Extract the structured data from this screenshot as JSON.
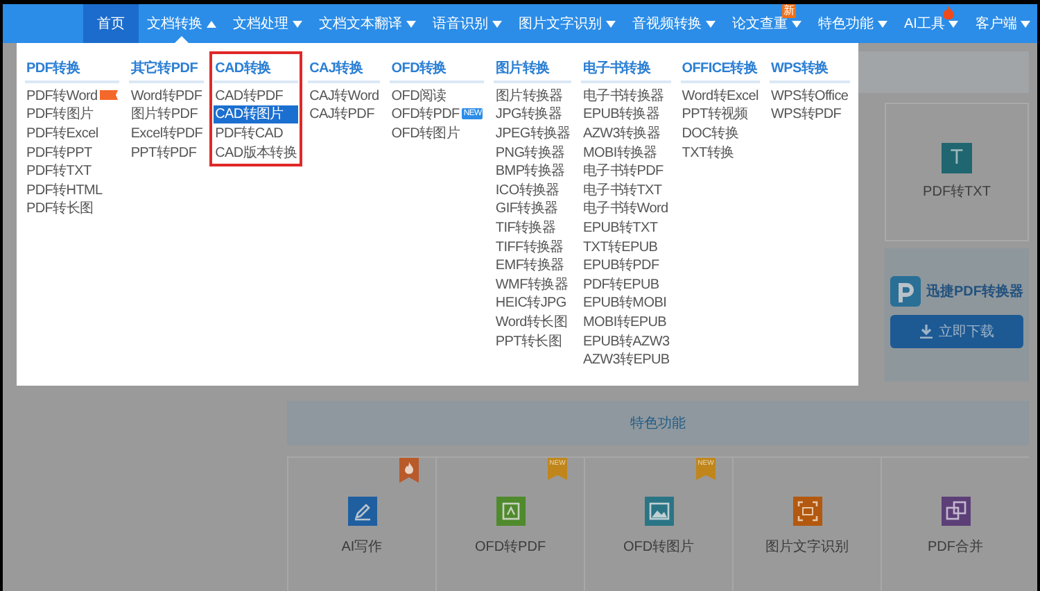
{
  "nav": {
    "items": [
      {
        "label": "首页",
        "selected": true,
        "has_menu": false,
        "expanded": false
      },
      {
        "label": "文档转换",
        "selected": false,
        "has_menu": true,
        "expanded": true
      },
      {
        "label": "文档处理",
        "selected": false,
        "has_menu": true,
        "expanded": false
      },
      {
        "label": "文档文本翻译",
        "selected": false,
        "has_menu": true,
        "expanded": false
      },
      {
        "label": "语音识别",
        "selected": false,
        "has_menu": true,
        "expanded": false
      },
      {
        "label": "图片文字识别",
        "selected": false,
        "has_menu": true,
        "expanded": false
      },
      {
        "label": "音视频转换",
        "selected": false,
        "has_menu": true,
        "expanded": false
      },
      {
        "label": "论文查重",
        "selected": false,
        "has_menu": true,
        "expanded": false,
        "badge": "新"
      },
      {
        "label": "特色功能",
        "selected": false,
        "has_menu": true,
        "expanded": false
      },
      {
        "label": "AI工具",
        "selected": false,
        "has_menu": true,
        "expanded": false,
        "hot": true
      },
      {
        "label": "客户端",
        "selected": false,
        "has_menu": true,
        "expanded": false
      }
    ]
  },
  "dropdown": {
    "columns": [
      {
        "title": "PDF转换",
        "highlighted": false,
        "items": [
          {
            "label": "PDF转Word",
            "selected": false,
            "hot_tag": true
          },
          {
            "label": "PDF转图片",
            "selected": false
          },
          {
            "label": "PDF转Excel",
            "selected": false
          },
          {
            "label": "PDF转PPT",
            "selected": false
          },
          {
            "label": "PDF转TXT",
            "selected": false
          },
          {
            "label": "PDF转HTML",
            "selected": false
          },
          {
            "label": "PDF转长图",
            "selected": false
          }
        ]
      },
      {
        "title": "其它转PDF",
        "highlighted": false,
        "items": [
          {
            "label": "Word转PDF",
            "selected": false
          },
          {
            "label": "图片转PDF",
            "selected": false
          },
          {
            "label": "Excel转PDF",
            "selected": false
          },
          {
            "label": "PPT转PDF",
            "selected": false
          }
        ]
      },
      {
        "title": "CAD转换",
        "highlighted": true,
        "items": [
          {
            "label": "CAD转PDF",
            "selected": false
          },
          {
            "label": "CAD转图片",
            "selected": true
          },
          {
            "label": "PDF转CAD",
            "selected": false
          },
          {
            "label": "CAD版本转换",
            "selected": false
          }
        ]
      },
      {
        "title": "CAJ转换",
        "highlighted": false,
        "items": [
          {
            "label": "CAJ转Word",
            "selected": false
          },
          {
            "label": "CAJ转PDF",
            "selected": false
          }
        ]
      },
      {
        "title": "OFD转换",
        "highlighted": false,
        "items": [
          {
            "label": "OFD阅读",
            "selected": false
          },
          {
            "label": "OFD转PDF",
            "selected": false,
            "badge": "NEW"
          },
          {
            "label": "OFD转图片",
            "selected": false
          }
        ]
      },
      {
        "title": "图片转换",
        "highlighted": false,
        "items": [
          {
            "label": "图片转换器",
            "selected": false
          },
          {
            "label": "JPG转换器",
            "selected": false
          },
          {
            "label": "JPEG转换器",
            "selected": false
          },
          {
            "label": "PNG转换器",
            "selected": false
          },
          {
            "label": "BMP转换器",
            "selected": false
          },
          {
            "label": "ICO转换器",
            "selected": false
          },
          {
            "label": "GIF转换器",
            "selected": false
          },
          {
            "label": "TIF转换器",
            "selected": false
          },
          {
            "label": "TIFF转换器",
            "selected": false
          },
          {
            "label": "EMF转换器",
            "selected": false
          },
          {
            "label": "WMF转换器",
            "selected": false
          },
          {
            "label": "HEIC转JPG",
            "selected": false
          },
          {
            "label": "Word转长图",
            "selected": false
          },
          {
            "label": "PPT转长图",
            "selected": false
          }
        ]
      },
      {
        "title": "电子书转换",
        "highlighted": false,
        "items": [
          {
            "label": "电子书转换器",
            "selected": false
          },
          {
            "label": "EPUB转换器",
            "selected": false
          },
          {
            "label": "AZW3转换器",
            "selected": false
          },
          {
            "label": "MOBI转换器",
            "selected": false
          },
          {
            "label": "电子书转PDF",
            "selected": false
          },
          {
            "label": "电子书转TXT",
            "selected": false
          },
          {
            "label": "电子书转Word",
            "selected": false
          },
          {
            "label": "EPUB转TXT",
            "selected": false
          },
          {
            "label": "TXT转EPUB",
            "selected": false
          },
          {
            "label": "EPUB转PDF",
            "selected": false
          },
          {
            "label": "PDF转EPUB",
            "selected": false
          },
          {
            "label": "EPUB转MOBI",
            "selected": false
          },
          {
            "label": "MOBI转EPUB",
            "selected": false
          },
          {
            "label": "EPUB转AZW3",
            "selected": false
          },
          {
            "label": "AZW3转EPUB",
            "selected": false
          }
        ]
      },
      {
        "title": "OFFICE转换",
        "highlighted": false,
        "items": [
          {
            "label": "Word转Excel",
            "selected": false
          },
          {
            "label": "PPT转视频",
            "selected": false
          },
          {
            "label": "DOC转换",
            "selected": false
          },
          {
            "label": "TXT转换",
            "selected": false
          }
        ]
      },
      {
        "title": "WPS转换",
        "highlighted": false,
        "items": [
          {
            "label": "WPS转Office",
            "selected": false
          },
          {
            "label": "WPS转PDF",
            "selected": false
          }
        ]
      }
    ]
  },
  "tool_card": {
    "label": "PDF转TXT",
    "icon_letter": "T"
  },
  "promo": {
    "name": "迅捷PDF转换器",
    "button": "立即下载"
  },
  "features": {
    "title": "特色功能",
    "items": [
      {
        "label": "AI写作",
        "color": "#1f5fa0",
        "ribbon": {
          "kind": "fire"
        }
      },
      {
        "label": "OFD转PDF",
        "color": "#4f8a2c",
        "ribbon": {
          "kind": "text",
          "text": "NEW"
        }
      },
      {
        "label": "OFD转图片",
        "color": "#2a7585",
        "ribbon": {
          "kind": "text",
          "text": "NEW"
        }
      },
      {
        "label": "图片文字识别",
        "color": "#b3580f",
        "ribbon": {
          "kind": "none"
        }
      },
      {
        "label": "PDF合并",
        "color": "#5d3f78",
        "ribbon": {
          "kind": "none"
        }
      }
    ]
  }
}
